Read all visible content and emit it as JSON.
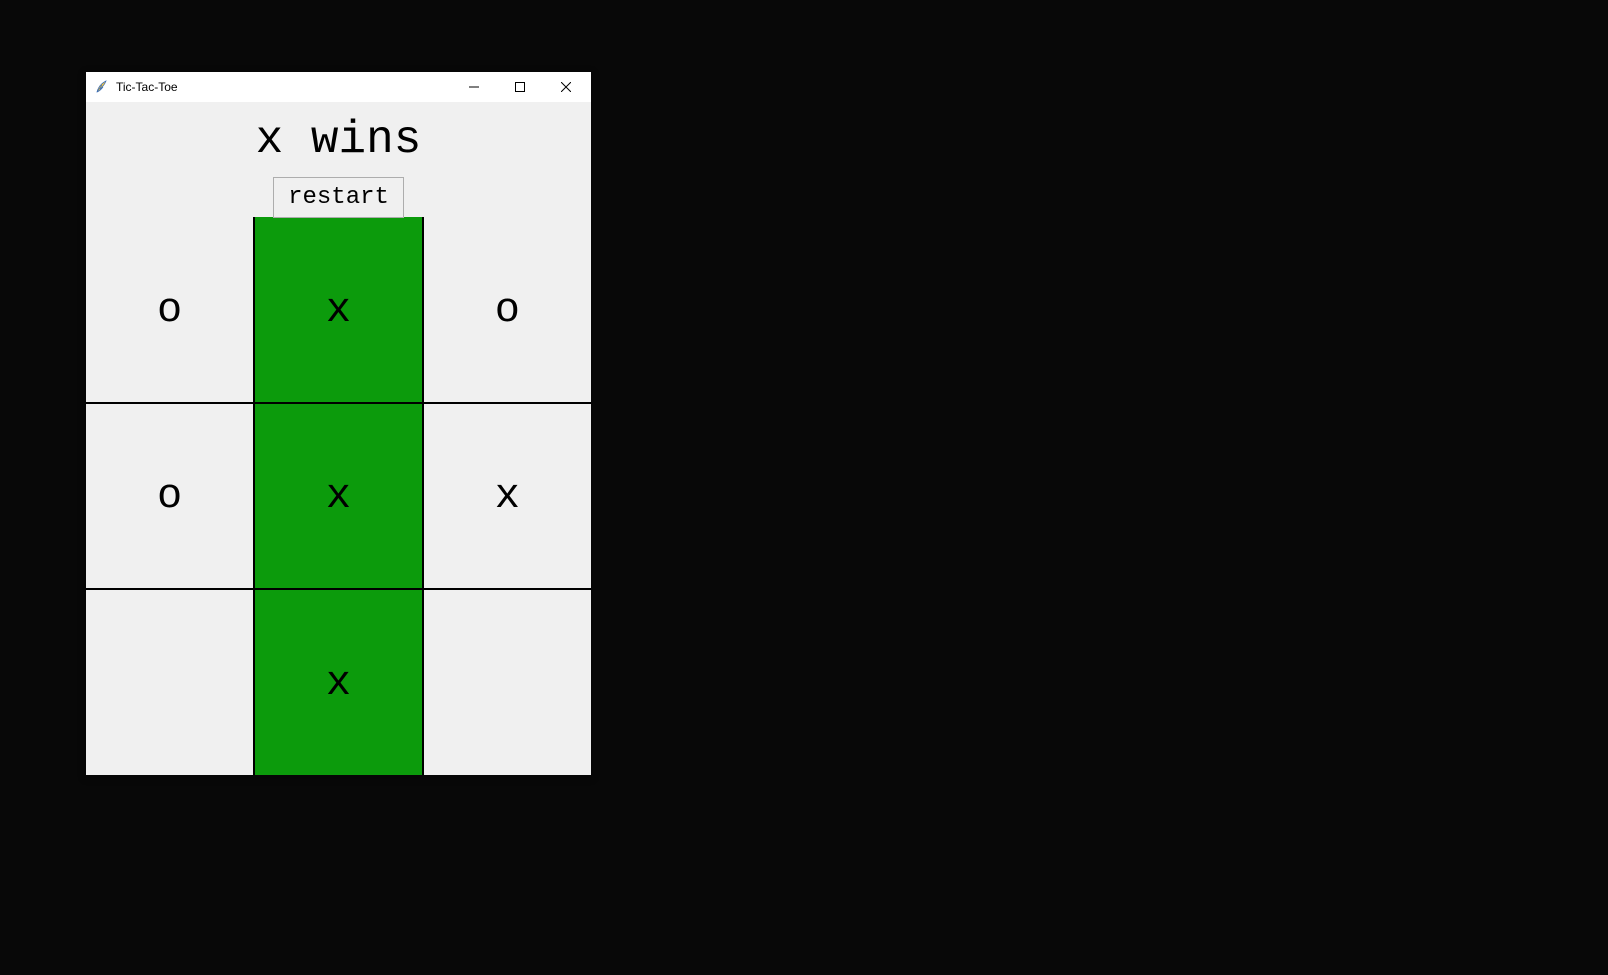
{
  "window": {
    "title": "Tic-Tac-Toe"
  },
  "game": {
    "status": "x wins",
    "restart_label": "restart",
    "cells": [
      {
        "value": "o",
        "winning": false
      },
      {
        "value": "x",
        "winning": true
      },
      {
        "value": "o",
        "winning": false
      },
      {
        "value": "o",
        "winning": false
      },
      {
        "value": "x",
        "winning": true
      },
      {
        "value": "x",
        "winning": false
      },
      {
        "value": "",
        "winning": false
      },
      {
        "value": "x",
        "winning": true
      },
      {
        "value": "",
        "winning": false
      }
    ]
  },
  "colors": {
    "win_bg": "#0c9b0c",
    "cell_bg": "#f0f0f0"
  }
}
